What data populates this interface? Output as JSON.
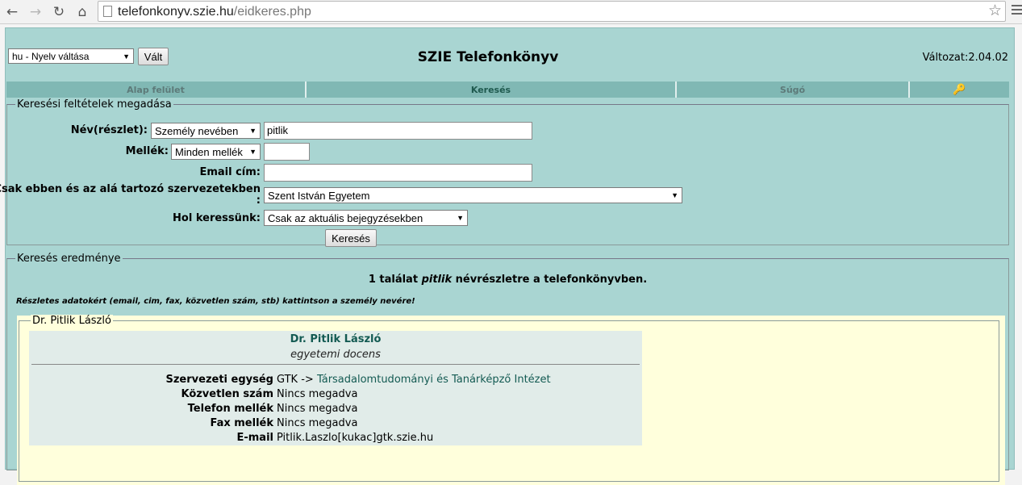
{
  "browser": {
    "url_host": "telefonkonyv.szie.hu",
    "url_path": "/eidkeres.php"
  },
  "header": {
    "language_select": "hu - Nyelv váltása",
    "language_button": "Vált",
    "title": "SZIE Telefonkönyv",
    "version": "Változat:2.04.02"
  },
  "tabs": [
    {
      "label": "Alap felület"
    },
    {
      "label": "Keresés"
    },
    {
      "label": "Súgó"
    }
  ],
  "criteria": {
    "legend": "Keresési feltételek megadása",
    "name_label": "Név(részlet):",
    "name_mode": "Személy nevében",
    "name_value": "pitlik",
    "extension_label": "Mellék:",
    "extension_mode": "Minden mellék",
    "extension_value": "",
    "email_label": "Email cím:",
    "email_value": "",
    "org_label_line1": "Csak ebben és az alá tartozó szervezetekben",
    "org_label_line2": ":",
    "org_value": "Szent István Egyetem",
    "where_label": "Hol keressünk:",
    "where_value": "Csak az aktuális bejegyzésekben",
    "search_button": "Keresés"
  },
  "results": {
    "legend": "Keresés eredménye",
    "summary_prefix": "1 találat ",
    "summary_term": "pitlik",
    "summary_suffix": " névrészletre a telefonkönyvben.",
    "hint": "Részletes adatokért (email, cim, fax, közvetlen szám, stb) kattintson a személy nevére!",
    "person": {
      "legend": "Dr. Pitlik László",
      "name": "Dr. Pitlik László",
      "role": "egyetemi docens",
      "org_label": "Szervezeti egység",
      "org_prefix": "GTK -> ",
      "org_unit": "Társadalomtudományi és Tanárképző Intézet",
      "direct_label": "Közvetlen szám",
      "direct_value": "Nincs megadva",
      "phone_label": "Telefon mellék",
      "phone_value": "Nincs megadva",
      "fax_label": "Fax mellék",
      "fax_value": "Nincs megadva",
      "email_label": "E-mail",
      "email_value": "Pitlik.Laszlo[kukac]gtk.szie.hu"
    }
  },
  "colors": {
    "page_bg": "#a9d5d2",
    "tab_bg": "#80b8b4",
    "result_bg": "#ffffdc",
    "card_bg": "#e1ece9",
    "link": "#135a52"
  }
}
